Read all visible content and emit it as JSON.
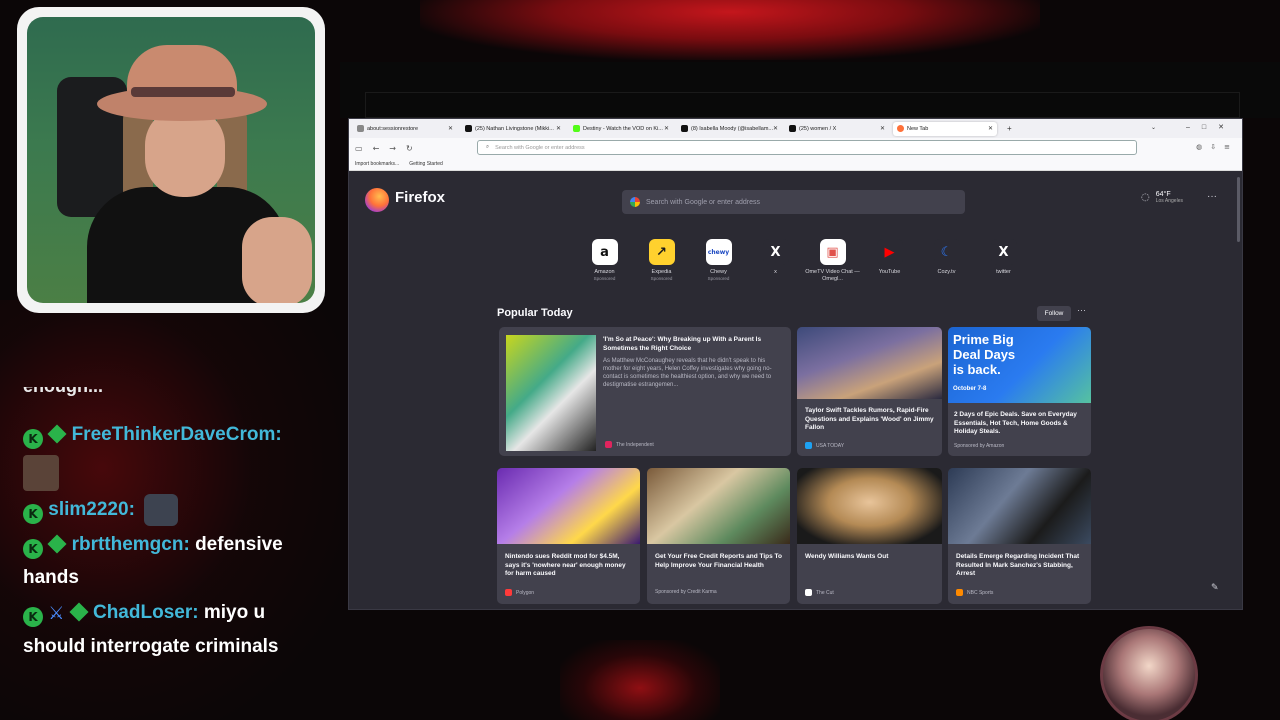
{
  "browser": {
    "tabs": [
      {
        "label": "about:sessionrestore",
        "active": false
      },
      {
        "label": "(25) Nathan Livingstone (Mikki...",
        "active": false
      },
      {
        "label": "Destiny - Watch the VOD on Ki...",
        "active": false
      },
      {
        "label": "(8) Isabella Moody (@isabellam...",
        "active": false
      },
      {
        "label": "(25) women / X",
        "active": false
      },
      {
        "label": "New Tab",
        "active": true
      }
    ],
    "url_placeholder": "Search with Google or enter address",
    "bookmarks": [
      "Import bookmarks...",
      "Getting Started"
    ]
  },
  "newtab": {
    "brand": "Firefox",
    "search_placeholder": "Search with Google or enter address",
    "weather": {
      "temp": "64°F",
      "city": "Los Angeles"
    },
    "shortcuts": [
      {
        "label": "Amazon",
        "sponsored": "Sponsored",
        "glyph": "a",
        "bg": "#ffffff",
        "fg": "#111111",
        "icon": "amazon-icon"
      },
      {
        "label": "Expedia",
        "sponsored": "Sponsored",
        "glyph": "↗",
        "bg": "#ffd12e",
        "fg": "#1b1b1b",
        "icon": "expedia-icon"
      },
      {
        "label": "Chewy",
        "sponsored": "Sponsored",
        "glyph": "chewy",
        "bg": "#ffffff",
        "fg": "#1c49c2",
        "icon": "chewy-icon"
      },
      {
        "label": "x",
        "sponsored": "",
        "glyph": "X",
        "bg": "#2b2a33",
        "fg": "#ffffff",
        "icon": "x-icon"
      },
      {
        "label": "OmeTV Video Chat — Omegl...",
        "sponsored": "",
        "glyph": "▣",
        "bg": "#ffffff",
        "fg": "#e0524b",
        "icon": "ometv-icon"
      },
      {
        "label": "YouTube",
        "sponsored": "",
        "glyph": "▶",
        "bg": "#2b2a33",
        "fg": "#ff0000",
        "icon": "youtube-icon"
      },
      {
        "label": "Cozy.tv",
        "sponsored": "",
        "glyph": "☾",
        "bg": "#2b2a33",
        "fg": "#2f7bff",
        "icon": "cozy-icon"
      },
      {
        "label": "twitter",
        "sponsored": "",
        "glyph": "X",
        "bg": "#2b2a33",
        "fg": "#ffffff",
        "icon": "twitter-icon"
      }
    ],
    "popular_title": "Popular Today",
    "follow_label": "Follow",
    "stories": [
      {
        "title": "'I'm So at Peace': Why Breaking up With a Parent Is Sometimes the Right Choice",
        "desc": "As Matthew McConaughey reveals that he didn't speak to his mother for eight years, Helen Coffey investigates why going no-contact is sometimes the healthiest option, and why we need to destigmatise estrangemen...",
        "source": "The Independent",
        "color": "#e0245e"
      },
      {
        "title": "Taylor Swift Tackles Rumors, Rapid-Fire Questions and Explains 'Wood' on Jimmy Fallon",
        "source": "USA TODAY",
        "color": "#1da1f2"
      },
      {
        "title": "2 Days of Epic Deals. Save on Everyday Essentials, Hot Tech, Home Goods & Holiday Steals.",
        "source": "Sponsored by Amazon",
        "ad_line1": "Prime Big",
        "ad_line2": "Deal Days",
        "ad_line3": "is back.",
        "ad_date": "October 7-8"
      },
      {
        "title": "Nintendo sues Reddit mod for $4.5M, says it's 'nowhere near' enough money for harm caused",
        "source": "Polygon",
        "color": "#ff3a3a"
      },
      {
        "title": "Get Your Free Credit Reports and Tips To Help Improve Your Financial Health",
        "source": "Sponsored by Credit Karma"
      },
      {
        "title": "Wendy Williams Wants Out",
        "source": "The Cut",
        "color": "#ffffff"
      },
      {
        "title": "Details Emerge Regarding Incident That Resulted In Mark Sanchez's Stabbing, Arrest",
        "source": "NBC Sports",
        "color": "#ff8a00"
      }
    ]
  },
  "chat": {
    "messages": [
      {
        "user": "FreeThinkerDaveCrom:",
        "text": ""
      },
      {
        "user": "slim2220:",
        "text": ""
      },
      {
        "user": "rbrtthemgcn:",
        "text": " defensive hands"
      },
      {
        "user": "ChadLoser:",
        "text": " miyo u should interrogate criminals"
      }
    ]
  },
  "colors": {
    "accent": "#42b8d9",
    "badge": "#2ab34a",
    "page_bg": "#2b2a33"
  }
}
